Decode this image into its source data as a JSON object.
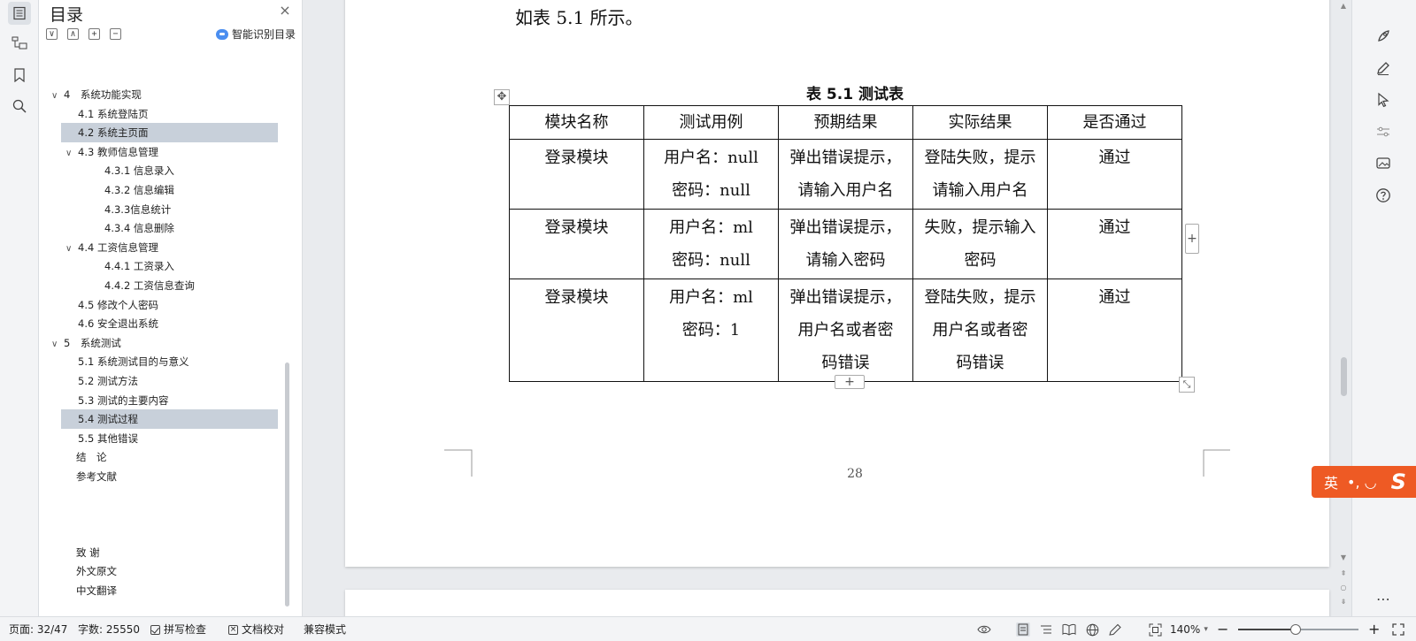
{
  "toc": {
    "title": "目录",
    "close": "×",
    "tools": [
      "∨",
      "∧",
      "+",
      "−"
    ],
    "smart_label": "智能识别目录",
    "items": [
      {
        "label": "4　系统功能实现",
        "level": 0,
        "chev": "∨"
      },
      {
        "label": "4.1 系统登陆页",
        "level": 1,
        "chev": ""
      },
      {
        "label": "4.2 系统主页面",
        "level": 1,
        "chev": "",
        "selected": true
      },
      {
        "label": "4.3 教师信息管理",
        "level": 1,
        "chev": "∨"
      },
      {
        "label": "4.3.1 信息录入",
        "level": 2,
        "chev": ""
      },
      {
        "label": "4.3.2 信息编辑",
        "level": 2,
        "chev": ""
      },
      {
        "label": "4.3.3信息统计",
        "level": 2,
        "chev": ""
      },
      {
        "label": "4.3.4 信息删除",
        "level": 2,
        "chev": ""
      },
      {
        "label": "4.4 工资信息管理",
        "level": 1,
        "chev": "∨"
      },
      {
        "label": "4.4.1 工资录入",
        "level": 2,
        "chev": ""
      },
      {
        "label": "4.4.2 工资信息查询",
        "level": 2,
        "chev": ""
      },
      {
        "label": "4.5 修改个人密码",
        "level": 1,
        "chev": ""
      },
      {
        "label": "4.6 安全退出系统",
        "level": 1,
        "chev": ""
      },
      {
        "label": "5　系统测试",
        "level": 0,
        "chev": "∨"
      },
      {
        "label": "5.1 系统测试目的与意义",
        "level": 1,
        "chev": ""
      },
      {
        "label": "5.2 测试方法",
        "level": 1,
        "chev": ""
      },
      {
        "label": "5.3 测试的主要内容",
        "level": 1,
        "chev": ""
      },
      {
        "label": "5.4 测试过程",
        "level": 1,
        "chev": "",
        "selected": true
      },
      {
        "label": "5.5 其他错误",
        "level": 1,
        "chev": ""
      },
      {
        "label": "结　论",
        "level": -1,
        "chev": ""
      },
      {
        "label": "参考文献",
        "level": -1,
        "chev": ""
      },
      {
        "label": "致 谢",
        "level": -1,
        "chev": "",
        "gap": true
      },
      {
        "label": "外文原文",
        "level": -1,
        "chev": ""
      },
      {
        "label": "中文翻译",
        "level": -1,
        "chev": ""
      }
    ]
  },
  "doc": {
    "intro": "如表 5.1 所示。",
    "caption": "表 5.1 测试表",
    "table": {
      "headers": [
        "模块名称",
        "测试用例",
        "预期结果",
        "实际结果",
        "是否通过"
      ],
      "rows": [
        [
          "登录模块",
          "用户名：null\n密码：null",
          "弹出错误提示，\n请输入用户名",
          "登陆失败，提示\n请输入用户名",
          "通过"
        ],
        [
          "登录模块",
          "用户名：ml\n密码：null",
          "弹出错误提示，\n请输入密码",
          "失败，提示输入\n密码",
          "通过"
        ],
        [
          "登录模块",
          "用户名：ml\n密码：1",
          "弹出错误提示，\n用户名或者密\n码错误",
          "登陆失败，提示\n用户名或者密\n码错误",
          "通过"
        ]
      ]
    },
    "page_number": "28",
    "add_symbol": "+",
    "resize_symbol": "⤡",
    "move_symbol": "✥"
  },
  "ime": {
    "lang": "英",
    "punct": "•, ◡",
    "logo": "S"
  },
  "status": {
    "page": "页面: 32/47",
    "words": "字数: 25550",
    "spell": "拼写检查",
    "proof": "文档校对",
    "compat": "兼容模式",
    "zoom": "140%",
    "zoom_minus": "−",
    "zoom_plus": "+",
    "zoom_arrow": "▾",
    "zoom_level": 0.48
  },
  "right_rail": {
    "more": "⋯"
  }
}
